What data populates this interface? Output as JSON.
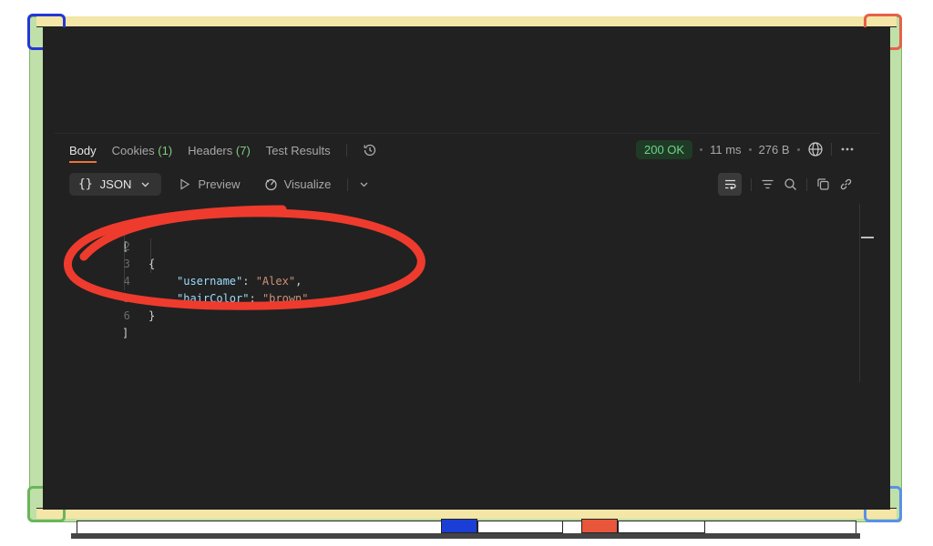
{
  "tabs": [
    {
      "label": "Body",
      "count": ""
    },
    {
      "label": "Cookies",
      "count": "(1)"
    },
    {
      "label": "Headers",
      "count": "(7)"
    },
    {
      "label": "Test Results",
      "count": ""
    }
  ],
  "status": {
    "code": "200 OK",
    "time": "11 ms",
    "size": "276 B"
  },
  "toolbar": {
    "format": "JSON",
    "format_braces": "{}",
    "preview": "Preview",
    "visualize": "Visualize"
  },
  "code_lines": [
    {
      "num": "1",
      "text": "["
    },
    {
      "num": "2",
      "text": "{"
    },
    {
      "num": "3",
      "key": "\"username\"",
      "sep": ": ",
      "value": "\"Alex\"",
      "end": ","
    },
    {
      "num": "4",
      "key": "\"hairColor\"",
      "sep": ": ",
      "value": "\"brown\"",
      "end": ""
    },
    {
      "num": "5",
      "text": "}"
    },
    {
      "num": "6",
      "text": "]"
    }
  ],
  "colors": {
    "accent": "#e8743b",
    "ok": "#6fd38a",
    "annotation": "#ee3b2e"
  }
}
